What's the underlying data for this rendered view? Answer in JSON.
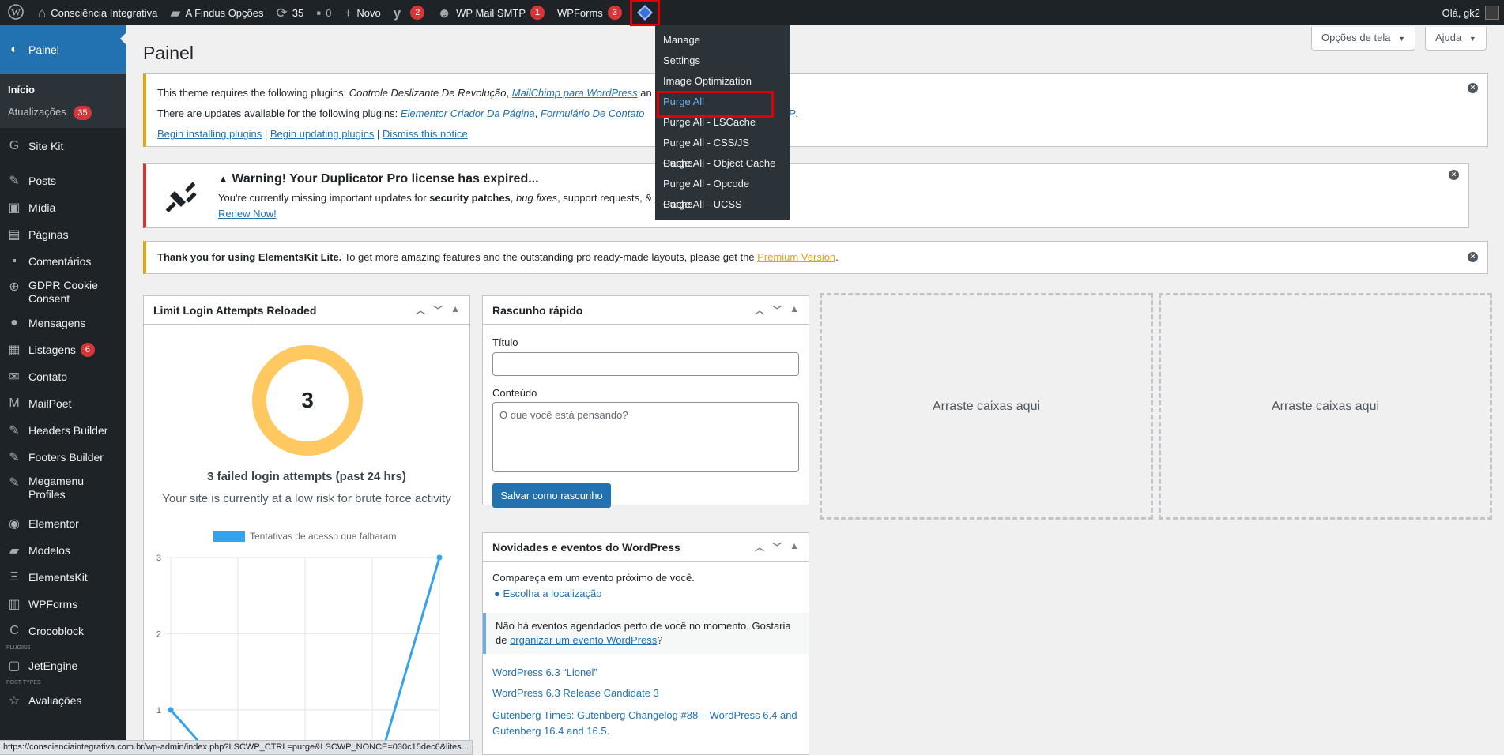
{
  "adminbar": {
    "site_name": "Consciência Integrativa",
    "findus": "A Findus Opções",
    "updates_count": "35",
    "comments_count": "0",
    "new_label": "Novo",
    "yoast_badge": "2",
    "wp_mail_smtp": "WP Mail SMTP",
    "wp_mail_smtp_badge": "1",
    "wpforms": "WPForms",
    "wpforms_badge": "3",
    "greeting": "Olá, gk2"
  },
  "ls_menu": {
    "items": [
      "Manage",
      "Settings",
      "Image Optimization",
      "Purge All",
      "Purge All - LSCache",
      "Purge All - CSS/JS Cache",
      "Purge All - Object Cache",
      "Purge All - Opcode Cache",
      "Purge All - UCSS"
    ]
  },
  "sidebar": {
    "dashboard": "Painel",
    "sub_home": "Início",
    "sub_updates": "Atualizações",
    "sub_updates_badge": "35",
    "items": [
      "Site Kit",
      "Posts",
      "Mídia",
      "Páginas",
      "Comentários",
      "GDPR Cookie Consent",
      "Mensagens",
      "Listagens",
      "Contato",
      "MailPoet",
      "Headers Builder",
      "Footers Builder",
      "Megamenu Profiles",
      "Elementor",
      "Modelos",
      "ElementsKit",
      "WPForms",
      "Crocoblock",
      "JetEngine",
      "Avaliações"
    ],
    "listagens_badge": "6",
    "sep_plugins": "PLUGINS",
    "sep_post_types": "POST TYPES"
  },
  "header": {
    "title": "Painel",
    "screen_options": "Opções de tela",
    "help": "Ajuda"
  },
  "notice_plugins": {
    "line1_prefix": "This theme requires the following plugins: ",
    "line1_plugin1": "Controle Deslizante De Revolução",
    "line1_sep": ", ",
    "line1_plugin2": "MailChimp para WordPress",
    "line1_tail": " an",
    "line2_prefix": "There are updates available for the following plugins: ",
    "line2_plugin1": "Elementor Criador Da Página",
    "line2_plugin2": "Formulário De Contato",
    "line2_tail_link": "VP",
    "line2_end": ".",
    "link_install": "Begin installing plugins",
    "link_update": "Begin updating plugins",
    "link_dismiss": "Dismiss this notice",
    "pipe": " | "
  },
  "notice_duplicator": {
    "title": "Warning! Your Duplicator Pro license has expired...",
    "body_prefix": "You're currently missing important updates for ",
    "body_bold": "security patches",
    "body_sep1": ", ",
    "body_italic": "bug fixes",
    "body_rest": ", support requests, & ",
    "body_link": "ne",
    "renew": "Renew Now!"
  },
  "notice_elementskit": {
    "bold": "Thank you for using ElementsKit Lite.",
    "text": " To get more amazing features and the outstanding pro ready-made layouts, please get the ",
    "link": "Premium Version",
    "end": "."
  },
  "limit_login": {
    "title": "Limit Login Attempts Reloaded",
    "count": "3",
    "failed_text": "3 failed login attempts (past 24 hrs)",
    "risk_text": "Your site is currently at a low risk for brute force activity",
    "legend": "Tentativas de acesso que falharam",
    "y_ticks": [
      "3",
      "2",
      "1",
      "0"
    ]
  },
  "chart_data": {
    "type": "line",
    "series": [
      {
        "name": "Tentativas de acesso que falharam",
        "values": [
          1,
          0,
          0,
          0,
          3
        ]
      }
    ],
    "ylim": [
      0,
      3
    ],
    "color": "#36a2eb"
  },
  "quick_draft": {
    "title": "Rascunho rápido",
    "title_label": "Título",
    "content_label": "Conteúdo",
    "content_placeholder": "O que você está pensando?",
    "save_button": "Salvar como rascunho"
  },
  "wp_news": {
    "title": "Novidades e eventos do WordPress",
    "nearby": "Compareça em um evento próximo de você.",
    "choose_location": "Escolha a localização",
    "no_events_prefix": "Não há eventos agendados perto de você no momento. Gostaria de ",
    "no_events_link": "organizar um evento WordPress",
    "no_events_end": "?",
    "links": [
      "WordPress 6.3 “Lionel”",
      "WordPress 6.3 Release Candidate 3",
      "Gutenberg Times: Gutenberg Changelog #88 – WordPress 6.4 and Gutenberg 16.4 and 16.5."
    ]
  },
  "dropzone_text": "Arraste caixas aqui",
  "status_url": "https://conscienciaintegrativa.com.br/wp-admin/index.php?LSCWP_CTRL=purge&LSCWP_NONCE=030c15dec6&lites..."
}
